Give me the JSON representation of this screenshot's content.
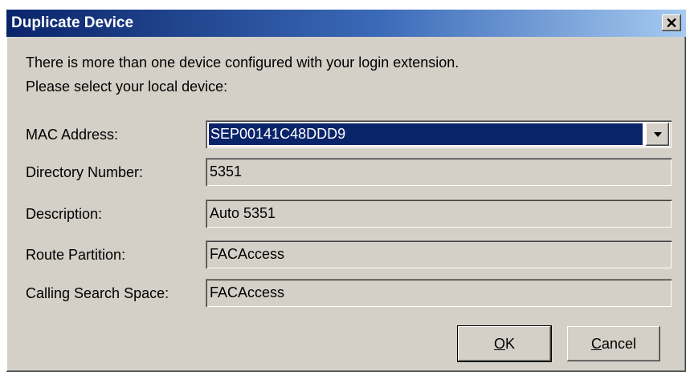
{
  "window": {
    "title": "Duplicate Device",
    "close_glyph": "✕"
  },
  "message": {
    "line1": "There is more than one device configured with your login extension.",
    "line2": "Please select your local device:"
  },
  "fields": {
    "mac": {
      "label": "MAC Address:",
      "value": "SEP00141C48DDD9"
    },
    "directory": {
      "label": "Directory Number:",
      "value": "5351"
    },
    "description": {
      "label": "Description:",
      "value": "Auto 5351"
    },
    "partition": {
      "label": "Route Partition:",
      "value": "FACAccess"
    },
    "css": {
      "label": "Calling Search Space:",
      "value": "FACAccess"
    }
  },
  "buttons": {
    "ok": {
      "accel": "O",
      "rest": "K"
    },
    "cancel": {
      "accel": "C",
      "rest": "ancel"
    }
  }
}
